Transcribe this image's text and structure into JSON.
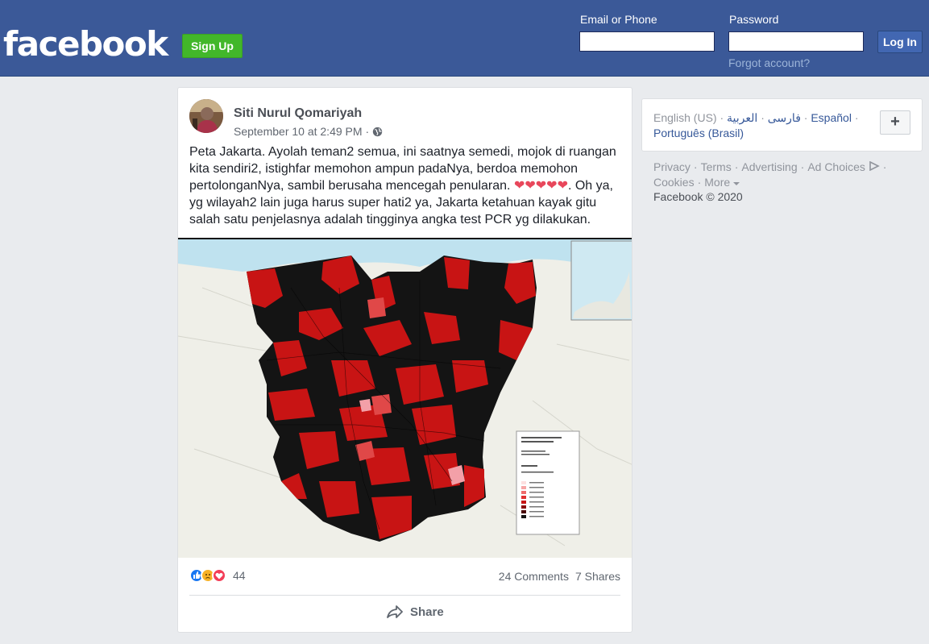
{
  "header": {
    "logo_text": "facebook",
    "signup_label": "Sign Up",
    "email_label": "Email or Phone",
    "email_value": "",
    "password_label": "Password",
    "password_value": "",
    "login_label": "Log In",
    "forgot_label": "Forgot account?"
  },
  "post": {
    "author": "Siti Nurul Qomariyah",
    "timestamp": "September 10 at 2:49 PM",
    "separator": "·",
    "privacy_icon": "globe-icon",
    "text_part1": "Peta Jakarta. Ayolah teman2 semua, ini saatnya semedi, mojok di ruangan kita sendiri2, istighfar memohon ampun padaNya, berdoa memohon pertolonganNya, sambil berusaha mencegah penularan. ",
    "hearts": "❤❤❤❤❤",
    "text_part2": ". Oh ya, yg wilayah2 lain juga harus super hati2 ya, Jakarta ketahuan kayak gitu salah satu penjelasnya adalah tingginya angka test PCR yg dilakukan.",
    "reaction_count": "44",
    "comments": "24 Comments",
    "shares": "7 Shares",
    "share_label": "Share"
  },
  "sidebar": {
    "current_language": "English (US)",
    "languages": [
      "فارسی",
      "العربية",
      "Español",
      "Português (Brasil)"
    ],
    "dot": " · ",
    "add_label": "+",
    "footer_links": [
      "Privacy",
      "Terms",
      "Advertising",
      "Ad Choices",
      "Cookies",
      "More"
    ],
    "copyright": "Facebook © 2020"
  },
  "colors": {
    "brand": "#3b5998",
    "signup_green": "#42b72a",
    "map_dark": "#111111",
    "map_red": "#d01818"
  }
}
